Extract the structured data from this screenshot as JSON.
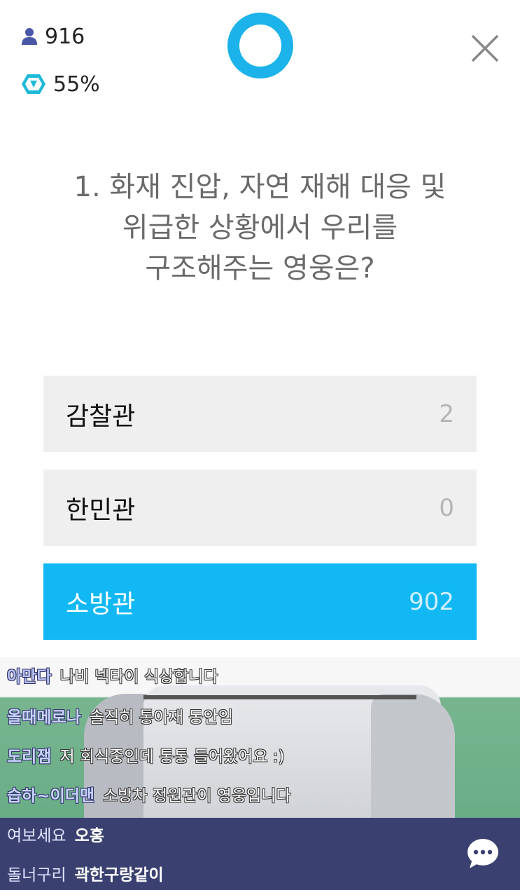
{
  "stats": {
    "viewers": "916",
    "percent": "55%"
  },
  "quiz": {
    "question_lines": [
      "1. 화재 진압, 자연 재해 대응 및",
      "위급한 상황에서 우리를",
      "구조해주는 영웅은?"
    ],
    "options": [
      {
        "label": "감찰관",
        "count": "2"
      },
      {
        "label": "한민관",
        "count": "0"
      },
      {
        "label": "소방관",
        "count": "902"
      }
    ]
  },
  "chat": {
    "messages": [
      {
        "user": "아만다",
        "text": "나비 넥타이 식상합니다"
      },
      {
        "user": "올때메로나",
        "text": "솔직히 통아재 동안임"
      },
      {
        "user": "도리잼",
        "text": "저 회식중인데 통통 들어왔어요 :)"
      },
      {
        "user": "습하~이더맨",
        "text": "소방차 정원관이 영웅입니다"
      },
      {
        "user": "여보세요",
        "text": "오홍"
      },
      {
        "user": "돌너구리",
        "text": "곽한구랑같이"
      }
    ]
  },
  "colors": {
    "accent": "#1bb3ea",
    "selected_option": "#11b8f3",
    "option_bg": "#efefef",
    "chat_panel": "#3a4170"
  },
  "icons": {
    "viewers": "person-icon",
    "percent": "hexagon-badge-icon",
    "close": "close-icon",
    "chat": "chat-bubble-icon"
  }
}
